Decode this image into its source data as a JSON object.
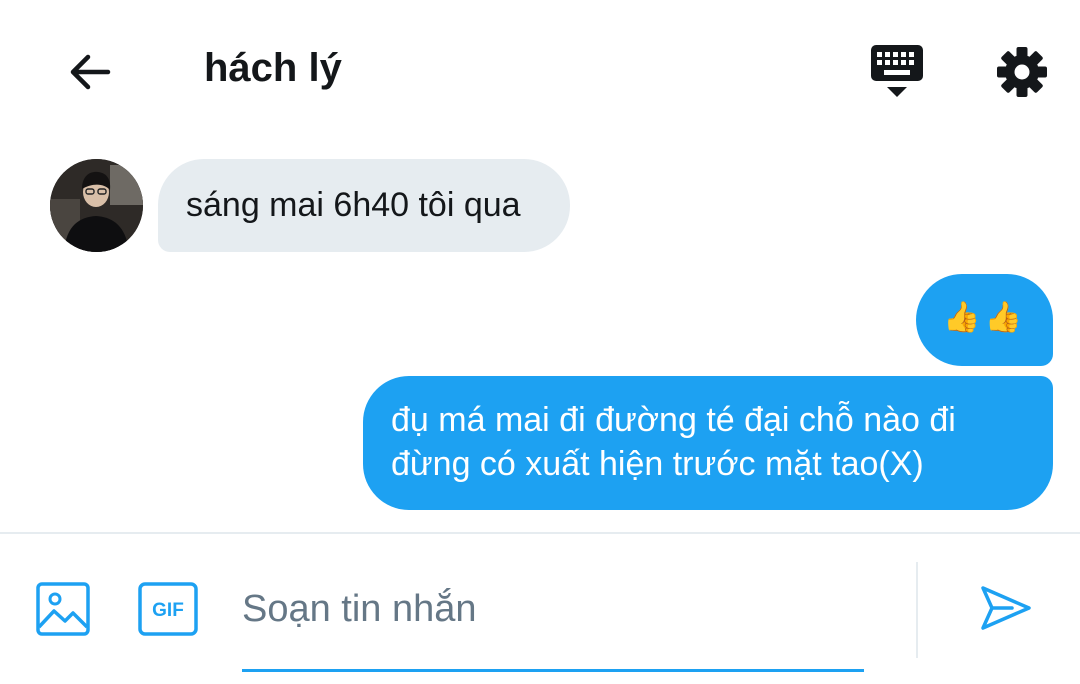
{
  "header": {
    "title": "hách lý",
    "back_icon": "arrow-left-icon",
    "keyboard_icon": "keyboard-icon",
    "settings_icon": "gear-icon"
  },
  "messages": [
    {
      "direction": "incoming",
      "text": "sáng mai 6h40 tôi qua"
    },
    {
      "direction": "outgoing",
      "text": "👍👍"
    },
    {
      "direction": "outgoing",
      "lines": [
        "đụ má mai đi đường té đại chỗ nào đi",
        "đừng có xuất hiện trước mặt tao(X)"
      ]
    }
  ],
  "composer": {
    "placeholder": "Soạn tin nhắn",
    "value": "",
    "media_icon": "image-icon",
    "gif_label": "GIF",
    "send_icon": "send-icon"
  },
  "colors": {
    "accent": "#1da1f2",
    "incoming_bubble": "#e6ecf0",
    "text_primary": "#14171a",
    "text_secondary": "#657786"
  }
}
